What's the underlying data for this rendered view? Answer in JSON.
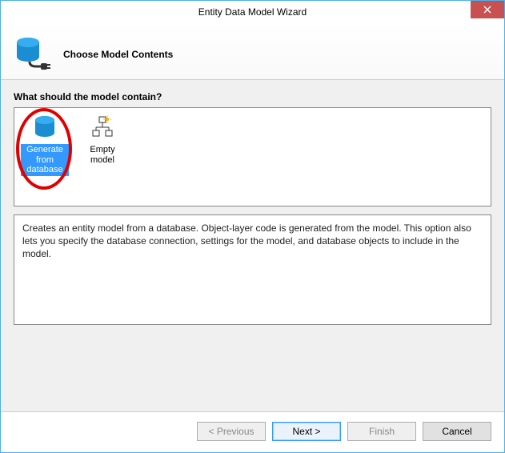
{
  "window": {
    "title": "Entity Data Model Wizard"
  },
  "header": {
    "subtitle": "Choose Model Contents"
  },
  "section": {
    "label": "What should the model contain?"
  },
  "options": {
    "generate": {
      "line1": "Generate",
      "line2": "from",
      "line3": "database",
      "selected": true
    },
    "empty": {
      "label": "Empty model",
      "selected": false
    }
  },
  "description": "Creates an entity model from a database. Object-layer code is generated from the model. This option also lets you specify the database connection, settings for the model, and database objects to include in the model.",
  "buttons": {
    "previous": "< Previous",
    "next": "Next >",
    "finish": "Finish",
    "cancel": "Cancel"
  }
}
